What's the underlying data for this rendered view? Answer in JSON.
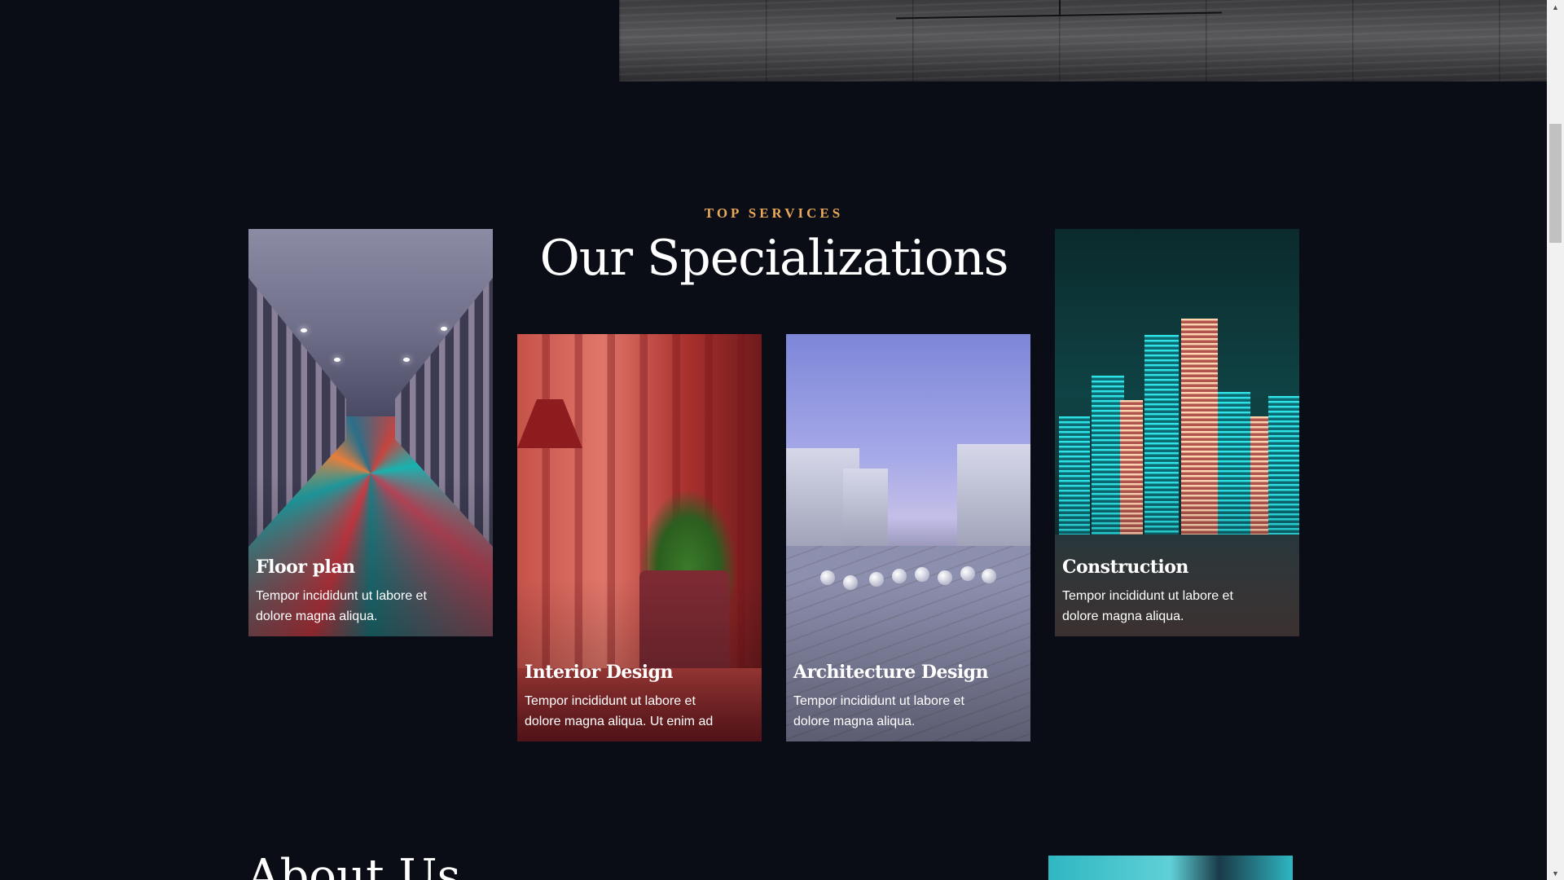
{
  "services": {
    "eyebrow": "TOP SERVICES",
    "title": "Our Specializations",
    "cards": [
      {
        "title": "Floor plan",
        "text": "Tempor incididunt ut labore et dolore magna aliqua."
      },
      {
        "title": "Interior Design",
        "text": "Tempor incididunt ut labore et dolore magna aliqua. Ut enim ad"
      },
      {
        "title": "Architecture Design",
        "text": "Tempor incididunt ut labore et dolore magna aliqua."
      },
      {
        "title": "Construction",
        "text": "Tempor incididunt ut labore et dolore magna aliqua."
      }
    ]
  },
  "about": {
    "title": "About Us"
  },
  "colors": {
    "background": "#0a0c16",
    "accent": "#e8a95a",
    "text": "#ffffff"
  },
  "icons": {
    "scroll_up": "triangle-up-icon",
    "scroll_down": "triangle-down-icon"
  }
}
